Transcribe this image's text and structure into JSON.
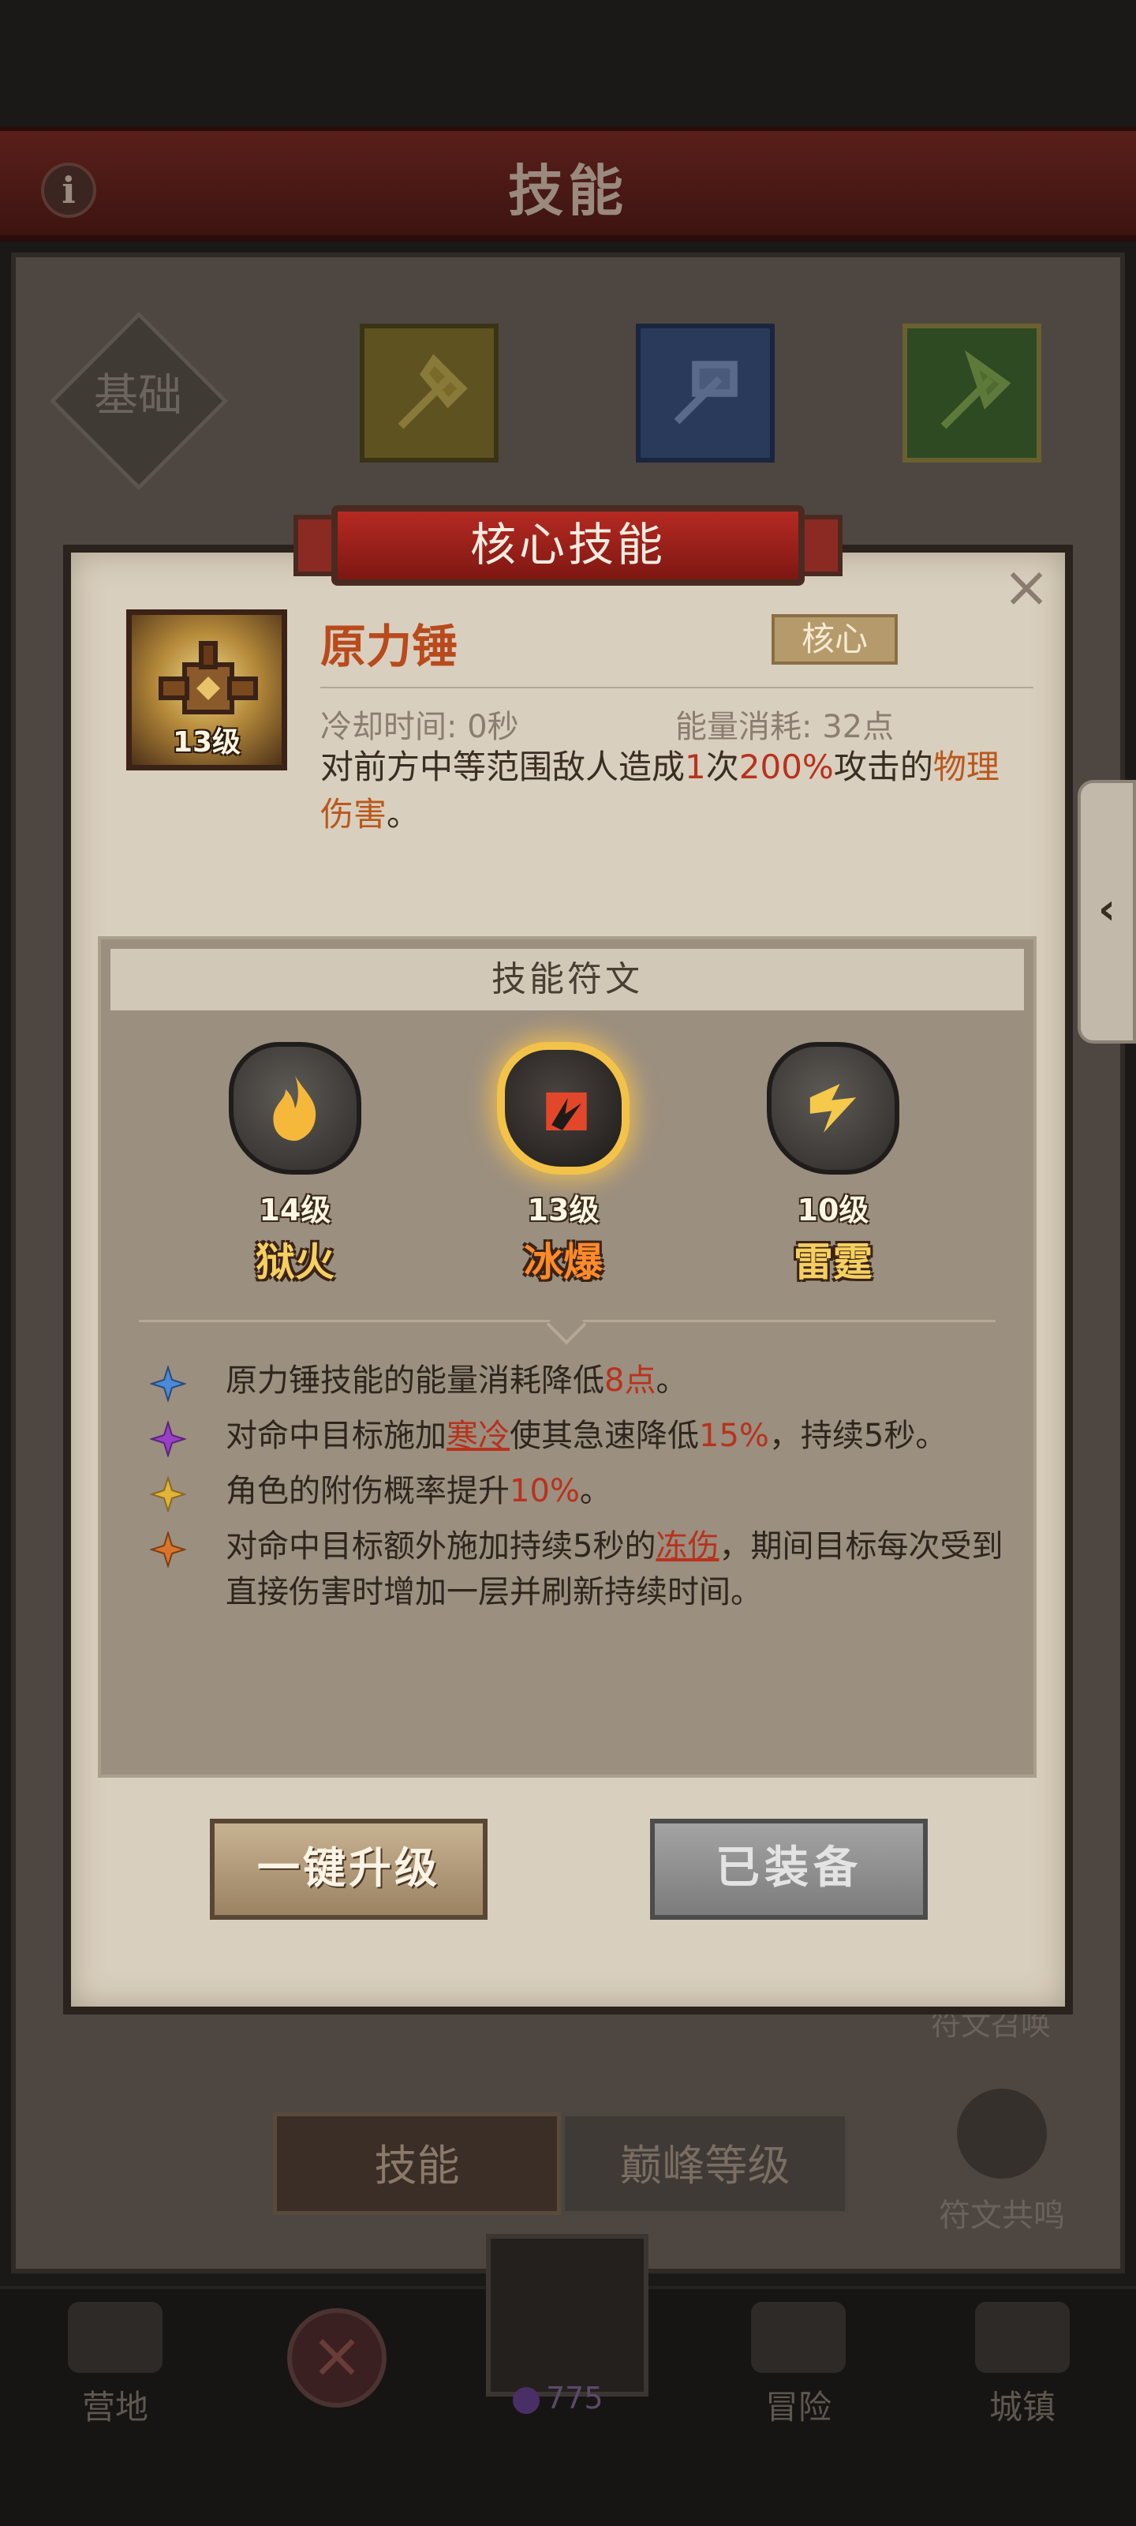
{
  "app": {
    "title": "技能",
    "info_icon": "info-icon"
  },
  "skill_tree": {
    "basic_tab_label": "基础",
    "trees": [
      {
        "icon": "axe-icon",
        "color": "#c4a033"
      },
      {
        "icon": "frost-hammer-icon",
        "color": "#3b6bb0"
      },
      {
        "icon": "nature-axe-icon",
        "color": "#4f8a30"
      }
    ]
  },
  "dialog": {
    "header": "核心技能",
    "close_icon": "close-icon",
    "skill": {
      "icon": "hammer-icon",
      "level": "13级",
      "name": "原力锤",
      "tag": "核心",
      "cooldown": "冷却时间: 0秒",
      "energy": "能量消耗: 32点",
      "description": {
        "part1": "对前方中等范围敌人造成",
        "highlight1": "1",
        "part2": "次",
        "highlight2": "200%",
        "part3": "攻击的",
        "highlight3": "物理伤害",
        "part4": "。"
      }
    },
    "runes_title": "技能符文",
    "runes": [
      {
        "icon": "fire-icon",
        "level": "14级",
        "name": "狱火",
        "selected": false
      },
      {
        "icon": "ice-burst-icon",
        "level": "13级",
        "name": "冰爆",
        "selected": true
      },
      {
        "icon": "thunder-icon",
        "level": "10级",
        "name": "雷霆",
        "selected": false
      }
    ],
    "effects": [
      {
        "color": "#4a8ad8",
        "p1": "原力锤技能的能量消耗降低",
        "h1": "8点",
        "p2": "。",
        "link": "",
        "p3": ""
      },
      {
        "color": "#9a3fc8",
        "p1": "对命中目标施加",
        "link": "寒冷",
        "p2": "使其急速降低",
        "h1": "15%",
        "p3": "，持续5秒。"
      },
      {
        "color": "#e0b43a",
        "p1": "角色的附伤概率提升",
        "h1": "10%",
        "p2": "。",
        "link": "",
        "p3": ""
      },
      {
        "color": "#d9752a",
        "p1": "对命中目标额外施加持续5秒的",
        "link": "冻伤",
        "p2": "，期间目标每次受到直接伤害时增加一层并刷新持续时间。",
        "h1": "",
        "p3": ""
      }
    ],
    "upgrade_button": "一键升级",
    "equipped_button": "已装备"
  },
  "side_tab": {
    "icon": "chevron-left-icon",
    "glyph": "‹"
  },
  "bottom": {
    "tab_skill": "技能",
    "tab_peak": "巅峰等级",
    "rune_summon": "符文召唤",
    "rune_resonance": "符文共鸣"
  },
  "navbar": {
    "camp": "营地",
    "adventure": "冒险",
    "town": "城镇",
    "gems": "775"
  }
}
